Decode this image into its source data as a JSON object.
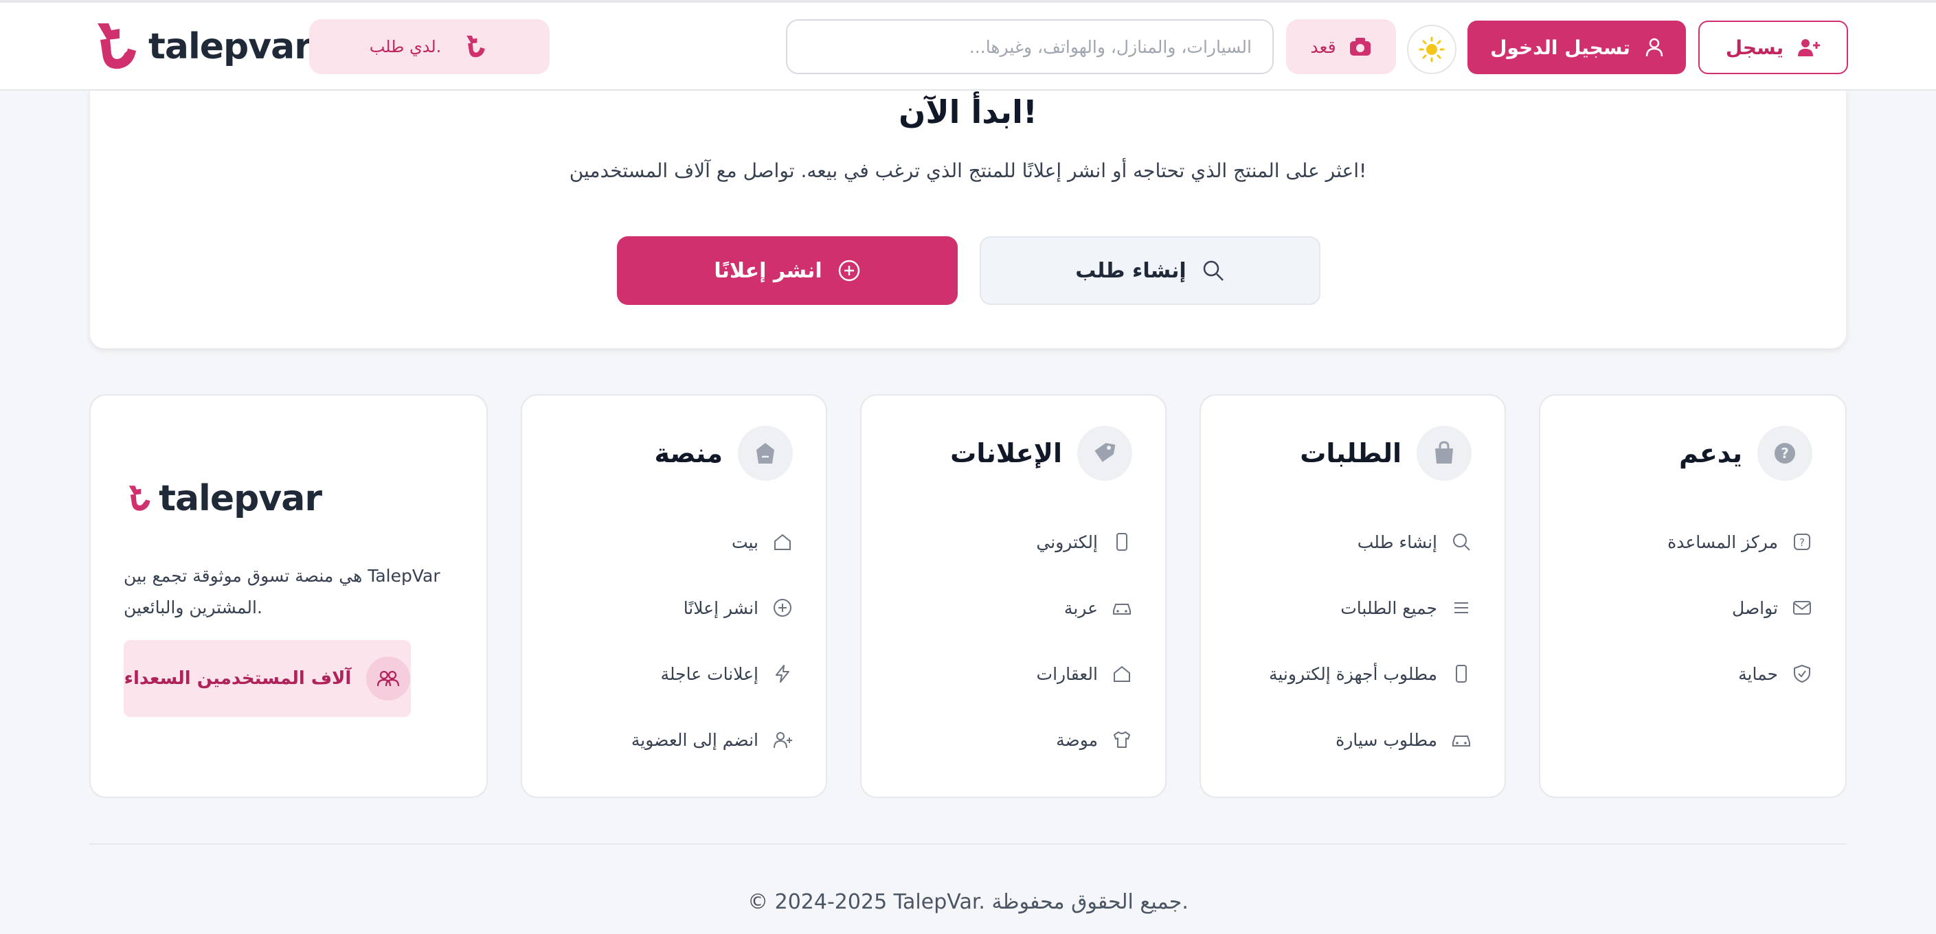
{
  "brand": {
    "name": "talepvar",
    "accent": "#d1306f",
    "accent_light": "#fbe4ec"
  },
  "header": {
    "request_pill_label": "لدي طلب.",
    "search_placeholder": "...السيارات، والمنازل، والهواتف، وغيرها",
    "camera_label": "قعد",
    "login_label": "تسجيل الدخول",
    "signup_label": "يسجل"
  },
  "hero": {
    "title": "ابدأ الآن!",
    "subtitle": "اعثر على المنتج الذي تحتاجه أو انشر إعلانًا للمنتج الذي ترغب في بيعه. تواصل مع آلاف المستخدمين!",
    "publish_label": "انشر إعلانًا",
    "create_request_label": "إنشاء طلب"
  },
  "brand_card": {
    "description": "هي منصة تسوق موثوقة تجمع بين TalepVar المشترين والبائعين.",
    "happy_users_label": "آلاف المستخدمين السعداء"
  },
  "cards": {
    "platform": {
      "title": "منصة",
      "items": [
        "بيت",
        "انشر إعلانًا",
        "إعلانات عاجلة",
        "انضم إلى العضوية"
      ]
    },
    "ads": {
      "title": "الإعلانات",
      "items": [
        "إلكتروني",
        "عربة",
        "العقارات",
        "موضة"
      ]
    },
    "requests": {
      "title": "الطلبات",
      "items": [
        "إنشاء طلب",
        "جميع الطلبات",
        "مطلوب أجهزة إلكترونية",
        "مطلوب سيارة"
      ]
    },
    "support": {
      "title": "يدعم",
      "items": [
        "مركز المساعدة",
        "تواصل",
        "حماية"
      ]
    }
  },
  "footer": {
    "copyright": "© 2024-2025 TalepVar. جميع الحقوق محفوظة."
  },
  "icons": [
    "logo-mark-icon",
    "camera-icon",
    "sun-icon",
    "user-icon",
    "user-plus-icon",
    "plus-circle-icon",
    "search-icon",
    "shopping-bag-icon",
    "tag-icon",
    "help-circle-icon",
    "home-icon",
    "bolt-icon",
    "phone-icon",
    "car-icon",
    "shirt-icon",
    "list-icon",
    "mail-icon",
    "shield-check-icon",
    "users-icon"
  ]
}
